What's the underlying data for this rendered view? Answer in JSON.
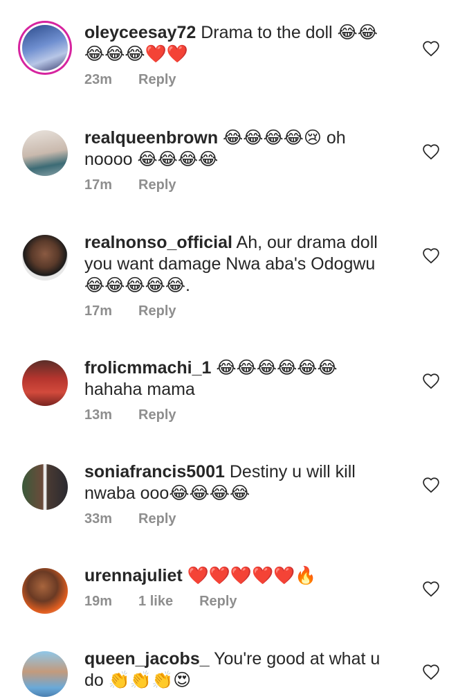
{
  "comments": [
    {
      "username": "oleyceesay72",
      "text": "Drama to the doll 😂😂😂😂😂❤️❤️",
      "time": "23m",
      "likes": "",
      "reply": "Reply"
    },
    {
      "username": "realqueenbrown",
      "text": "😂😂😂😂😢 oh noooo 😂😂😂😂",
      "time": "17m",
      "likes": "",
      "reply": "Reply"
    },
    {
      "username": "realnonso_official",
      "text": "Ah, our drama doll you want damage Nwa aba's Odogwu 😂😂😂😂😂.",
      "time": "17m",
      "likes": "",
      "reply": "Reply"
    },
    {
      "username": "frolicmmachi_1",
      "text": "😂😂😂😂😂😂 hahaha mama",
      "time": "13m",
      "likes": "",
      "reply": "Reply"
    },
    {
      "username": "soniafrancis5001",
      "text": "Destiny u will kill nwaba ooo😂😂😂😂",
      "time": "33m",
      "likes": "",
      "reply": "Reply"
    },
    {
      "username": "urennajuliet",
      "text": "❤️❤️❤️❤️❤️🔥",
      "time": "19m",
      "likes": "1 like",
      "reply": "Reply"
    },
    {
      "username": "queen_jacobs_",
      "text": "You're good at what u do 👏👏👏😍",
      "time": "",
      "likes": "",
      "reply": ""
    }
  ],
  "icons": {
    "like": "heart-outline-icon"
  },
  "colors": {
    "text": "#262626",
    "meta": "#8e8e8e",
    "story_ring": "#d6249f"
  }
}
